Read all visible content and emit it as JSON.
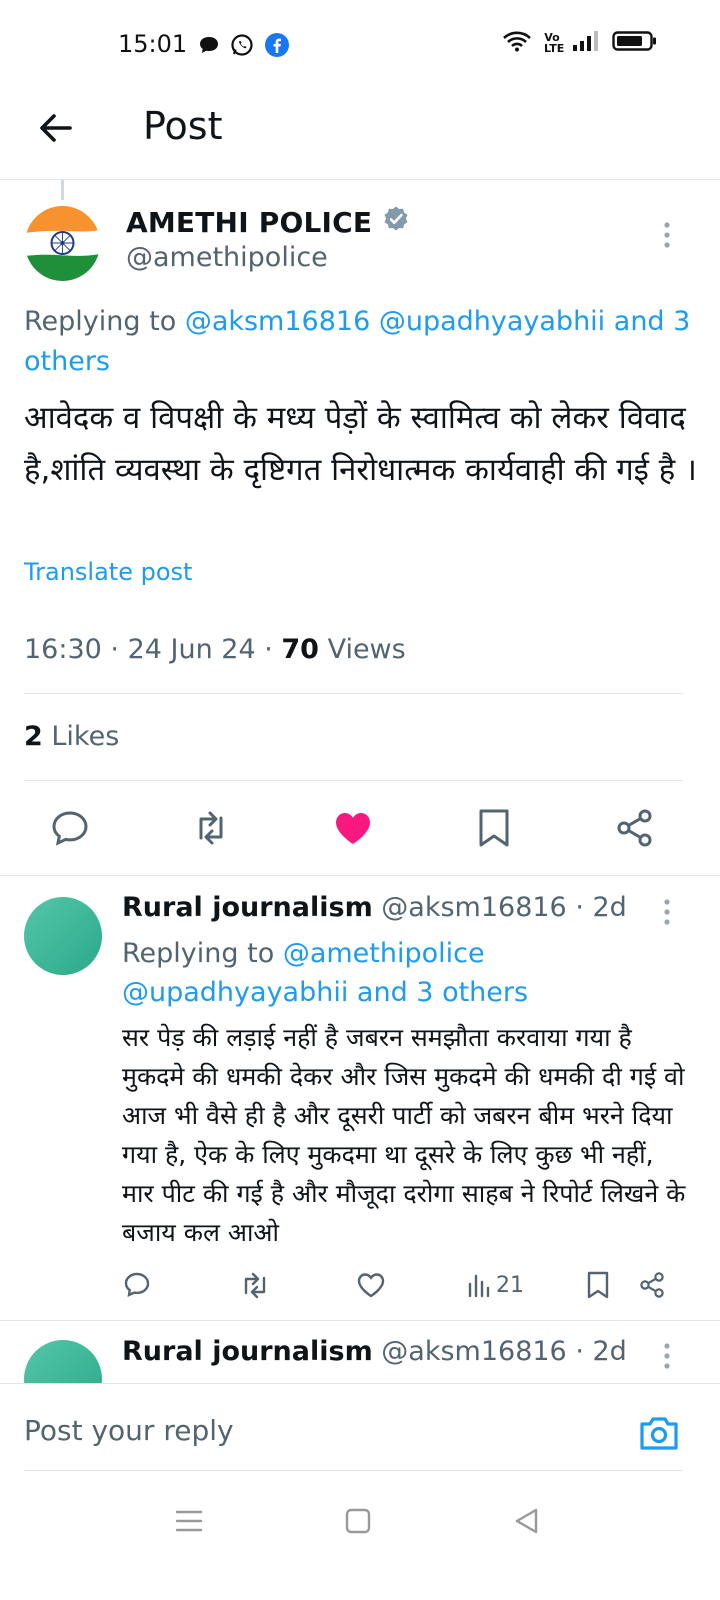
{
  "status_bar": {
    "time": "15:01",
    "left_icons": [
      "chat-bubble-icon",
      "whatsapp-icon",
      "facebook-icon"
    ],
    "right_icons": [
      "wifi-icon",
      "volte-icon",
      "signal-icon",
      "battery-icon"
    ],
    "volte_label": "Vo LTE"
  },
  "header": {
    "title": "Post"
  },
  "post": {
    "author_name": "AMETHI POLICE",
    "author_handle": "@amethipolice",
    "replying_prefix": "Replying to ",
    "replying_links": "@aksm16816 @upadhyayabhii and 3 others",
    "body": "आवेदक व विपक्षी के मध्य पेड़ों के स्वामित्व को लेकर विवाद है,शांति व्यवस्था के दृष्टिगत निरोधात्मक कार्यवाही की गई है ।",
    "translate_label": "Translate post",
    "time": "16:30",
    "date": "24 Jun 24",
    "views_count": "70",
    "views_label": "Views",
    "likes_count": "2",
    "likes_label": "Likes",
    "liked": true
  },
  "replies": [
    {
      "name": "Rural journalism",
      "handle": "@aksm16816",
      "age": "2d",
      "replying_prefix": "Replying to ",
      "replying_links": "@amethipolice @upadhyayabhii and 3 others",
      "body": "सर पेड़ की लड़ाई नहीं है जबरन समझौता करवाया गया है मुकदमे की धमकी देकर और जिस मुकदमे की धमकी दी गई वो आज भी वैसे ही है और दूसरी पार्टी को जबरन बीम भरने दिया गया है, ऐक के लिए मुकदमा था दूसरे के लिए कुछ भी नहीं, मार पीट की गई है और मौजूदा दरोगा साहब ने रिपोर्ट लिखने के बजाय कल आओ",
      "views": "21"
    },
    {
      "name": "Rural journalism",
      "handle": "@aksm16816",
      "age": "2d"
    }
  ],
  "compose": {
    "placeholder": "Post your reply"
  },
  "colors": {
    "accent": "#1d9bf0",
    "like": "#f91880",
    "text": "#0f1419",
    "muted": "#536471"
  }
}
